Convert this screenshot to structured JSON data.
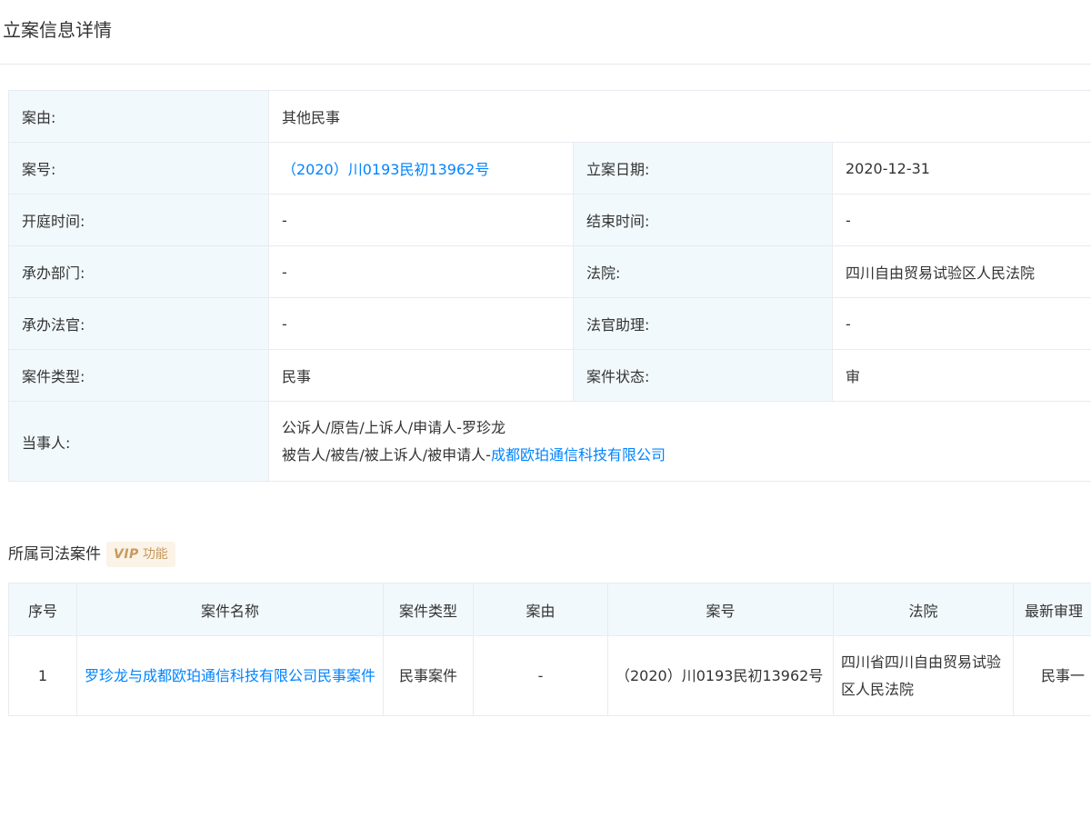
{
  "header": {
    "title": "立案信息详情"
  },
  "detail": {
    "cause_label": "案由:",
    "cause_value": "其他民事",
    "case_no_label": "案号:",
    "case_no_value": "（2020）川0193民初13962号",
    "filing_date_label": "立案日期:",
    "filing_date_value": "2020-12-31",
    "hearing_time_label": "开庭时间:",
    "hearing_time_value": "-",
    "end_time_label": "结束时间:",
    "end_time_value": "-",
    "department_label": "承办部门:",
    "department_value": "-",
    "court_label": "法院:",
    "court_value": "四川自由贸易试验区人民法院",
    "judge_label": "承办法官:",
    "judge_value": "-",
    "assistant_label": "法官助理:",
    "assistant_value": "-",
    "case_type_label": "案件类型:",
    "case_type_value": "民事",
    "case_status_label": "案件状态:",
    "case_status_value": "审",
    "parties_label": "当事人:",
    "plaintiff_line": "公诉人/原告/上诉人/申请人-罗珍龙",
    "defendant_prefix": "被告人/被告/被上诉人/被申请人-",
    "defendant_name": "成都欧珀通信科技有限公司"
  },
  "related": {
    "title": "所属司法案件",
    "vip_logo": "VIP",
    "vip_text": "功能",
    "columns": [
      "序号",
      "案件名称",
      "案件类型",
      "案由",
      "案号",
      "法院",
      "最新审理"
    ],
    "rows": [
      {
        "index": "1",
        "name": "罗珍龙与成都欧珀通信科技有限公司民事案件",
        "type": "民事案件",
        "cause": "-",
        "case_no": "（2020）川0193民初13962号",
        "court": "四川省四川自由贸易试验区人民法院",
        "latest": "民事一"
      }
    ]
  },
  "colors": {
    "link": "#0084ff",
    "label_bg": "#f2f9fc",
    "border": "#e8ebef",
    "vip_bg": "#fbf3e7",
    "vip_text": "#c69a5a"
  }
}
